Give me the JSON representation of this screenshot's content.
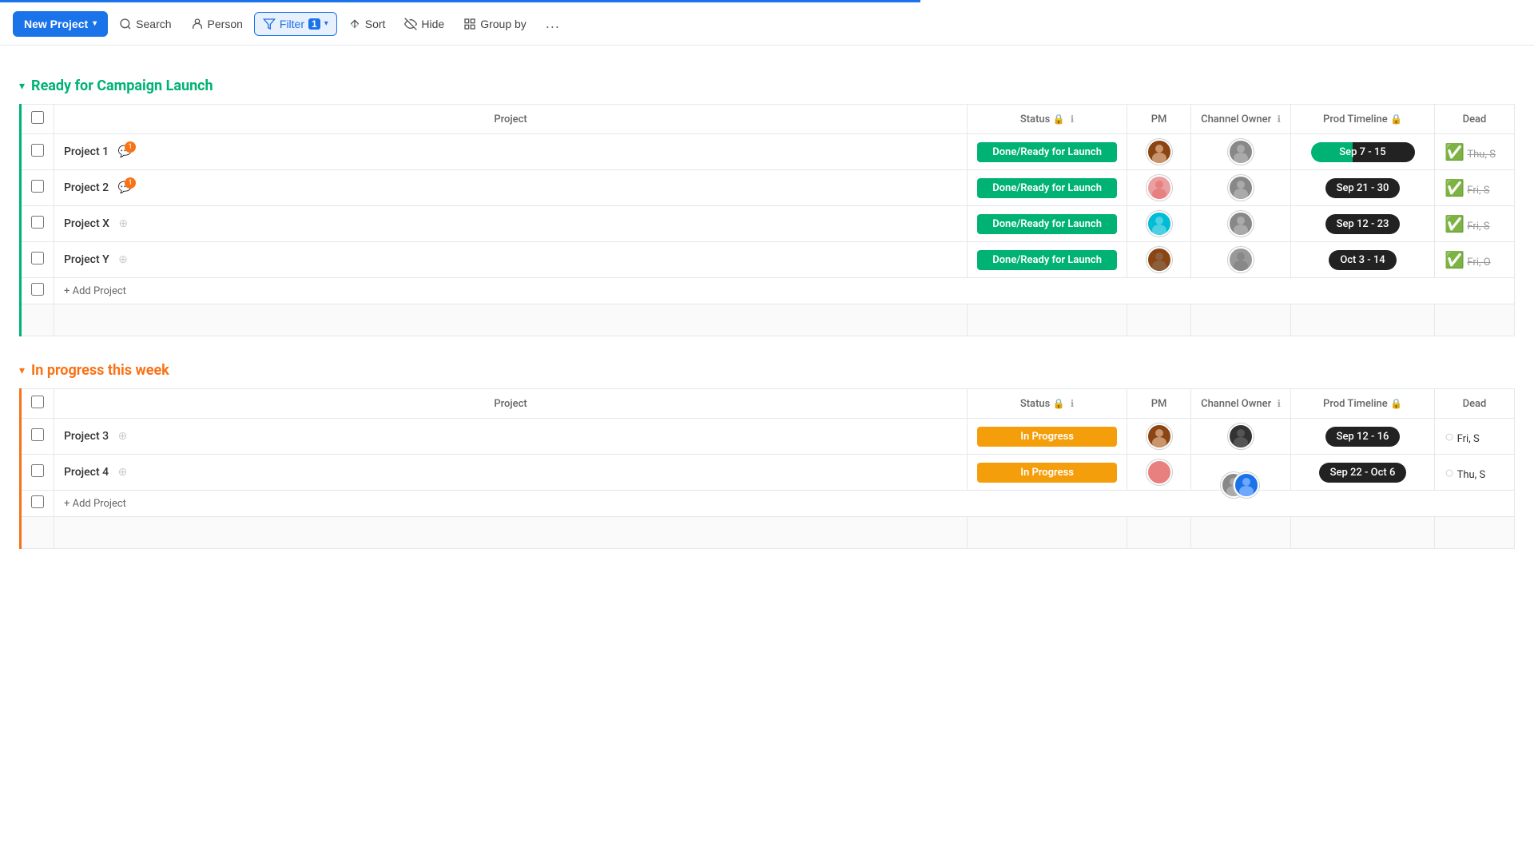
{
  "progressBar": {
    "width": "60%"
  },
  "toolbar": {
    "newProject": "New Project",
    "search": "Search",
    "person": "Person",
    "filter": "Filter",
    "filterCount": "1",
    "sort": "Sort",
    "hide": "Hide",
    "groupBy": "Group by",
    "more": "..."
  },
  "groups": [
    {
      "id": "ready",
      "title": "Ready for Campaign Launch",
      "color": "green",
      "projects": [
        {
          "name": "Project 1",
          "status": "Done/Ready for Launch",
          "statusColor": "green",
          "pm": "🧑‍🦱",
          "channelOwner": "👤",
          "timeline": "Sep 7 - 15",
          "timelineType": "progress",
          "deadline": "Thu, S",
          "deadlineDone": true,
          "chatType": "blue",
          "notif": "1"
        },
        {
          "name": "Project 2",
          "status": "Done/Ready for Launch",
          "statusColor": "green",
          "pm": "🧑‍🦰",
          "channelOwner": "👤",
          "timeline": "Sep 21 - 30",
          "timelineType": "dark",
          "deadline": "Fri, S",
          "deadlineDone": true,
          "chatType": "blue",
          "notif": "1"
        },
        {
          "name": "Project X",
          "status": "Done/Ready for Launch",
          "statusColor": "green",
          "pm": "🧑‍🦱",
          "channelOwner": "👤",
          "timeline": "Sep 12 - 23",
          "timelineType": "dark",
          "deadline": "Fri, S",
          "deadlineDone": true,
          "chatType": "gray",
          "notif": ""
        },
        {
          "name": "Project Y",
          "status": "Done/Ready for Launch",
          "statusColor": "green",
          "pm": "🧑‍🦱",
          "channelOwner": "👤",
          "timeline": "Oct 3 - 14",
          "timelineType": "dark",
          "deadline": "Fri, O",
          "deadlineDone": true,
          "chatType": "gray",
          "notif": ""
        }
      ],
      "addLabel": "+ Add Project",
      "columns": {
        "project": "Project",
        "status": "Status",
        "pm": "PM",
        "channelOwner": "Channel Owner",
        "prodTimeline": "Prod Timeline",
        "deadline": "Dead"
      }
    },
    {
      "id": "inprogress",
      "title": "In progress this week",
      "color": "orange",
      "projects": [
        {
          "name": "Project 3",
          "status": "In Progress",
          "statusColor": "orange",
          "pm": "🧑‍🦱",
          "channelOwner": "👤",
          "timeline": "Sep 12 - 16",
          "timelineType": "dark",
          "deadline": "Fri, S",
          "deadlineDone": false,
          "chatType": "gray",
          "notif": ""
        },
        {
          "name": "Project 4",
          "status": "In Progress",
          "statusColor": "orange",
          "pm": "🧑‍🦰",
          "channelOwner": "👥",
          "timeline": "Sep 22 - Oct 6",
          "timelineType": "dark",
          "deadline": "Thu, S",
          "deadlineDone": false,
          "chatType": "gray",
          "notif": ""
        }
      ],
      "addLabel": "+ Add Project",
      "columns": {
        "project": "Project",
        "status": "Status",
        "pm": "PM",
        "channelOwner": "Channel Owner",
        "prodTimeline": "Prod Timeline",
        "deadline": "Dead"
      }
    }
  ]
}
